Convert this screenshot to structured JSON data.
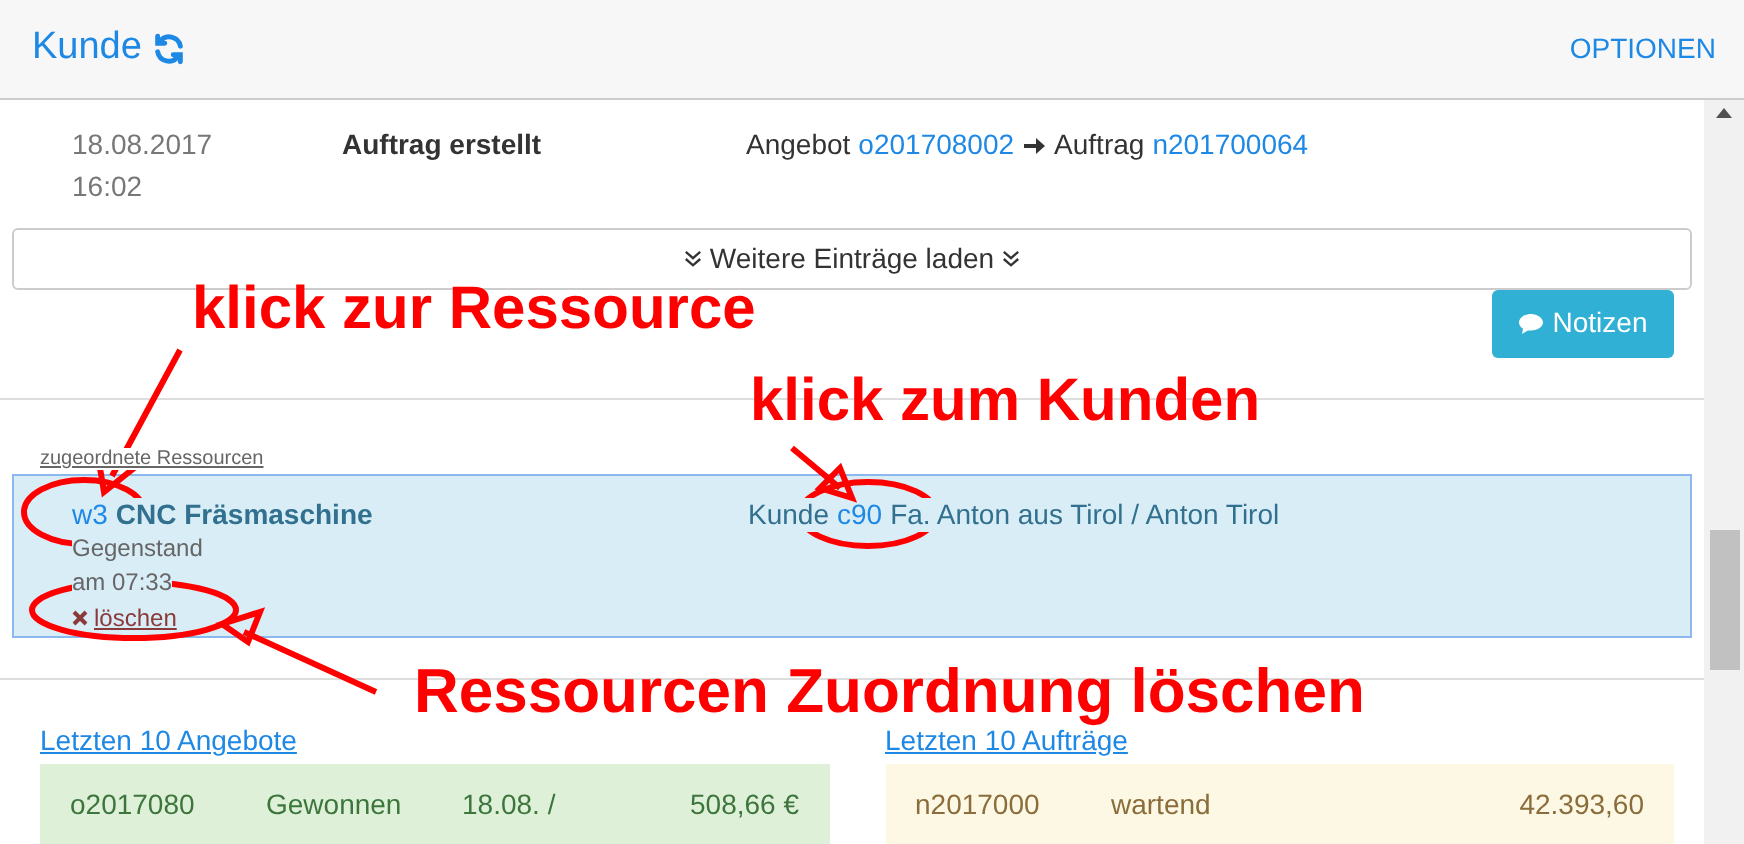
{
  "header": {
    "title": "Kunde",
    "options": "OPTIONEN"
  },
  "events": [
    {
      "date": "18.08.2017",
      "time": "16:02",
      "action": "Auftrag erstellt",
      "offer_label": "Angebot",
      "offer_link": "o201708002",
      "order_label": "Auftrag",
      "order_link": "n201700064"
    }
  ],
  "load_more": "Weitere Einträge laden",
  "notes_button": "Notizen",
  "resources": {
    "heading": "zugeordnete Ressourcen",
    "items": [
      {
        "id": "w3",
        "name": "CNC Fräsmaschine",
        "type": "Gegenstand",
        "time": "am 07:33",
        "delete": "löschen",
        "customer_label": "Kunde",
        "customer_id": "c90",
        "customer_name": "Fa. Anton aus Tirol / Anton Tirol"
      }
    ]
  },
  "lists": [
    {
      "kind": "offers",
      "title": "Letzten 10 Angebote",
      "rows": [
        {
          "cells": [
            "o2017080",
            "Gewonnen",
            "18.08. /",
            "508,66 €"
          ]
        }
      ]
    },
    {
      "kind": "orders",
      "title": "Letzten 10 Aufträge",
      "rows": [
        {
          "cells": [
            "n2017000",
            "wartend",
            "42.393,60"
          ]
        }
      ]
    }
  ],
  "annotations": [
    "klick zur Ressource",
    "klick zum Kunden",
    "Ressourcen Zuordnung löschen"
  ]
}
